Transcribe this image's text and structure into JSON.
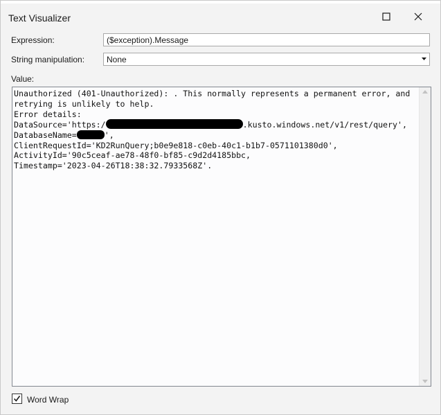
{
  "window": {
    "title": "Text Visualizer"
  },
  "expression": {
    "label": "Expression:",
    "value": "($exception).Message"
  },
  "string_manipulation": {
    "label": "String manipulation:",
    "selected": "None"
  },
  "value": {
    "label": "Value:",
    "line1": "Unauthorized (401-Unauthorized): . This normally represents a permanent error, and",
    "line2": "retrying is unlikely to help.",
    "line3": "Error details:",
    "line4_a": "DataSource='https:/",
    "line4_b": ".kusto.windows.net/v1/rest/query',",
    "line5_a": "DatabaseName=",
    "line5_b": "',",
    "line6": "ClientRequestId='KD2RunQuery;b0e9e818-c0eb-40c1-b1b7-0571101380d0',",
    "line7": "ActivityId='90c5ceaf-ae78-48f0-bf85-c9d2d4185bbc,",
    "line8": "Timestamp='2023-04-26T18:38:32.7933568Z'."
  },
  "word_wrap": {
    "label": "Word Wrap",
    "checked": true
  },
  "icons": {
    "maximize": "maximize-icon",
    "close": "close-icon",
    "dropdown": "chevron-down-icon",
    "check": "check-icon"
  }
}
